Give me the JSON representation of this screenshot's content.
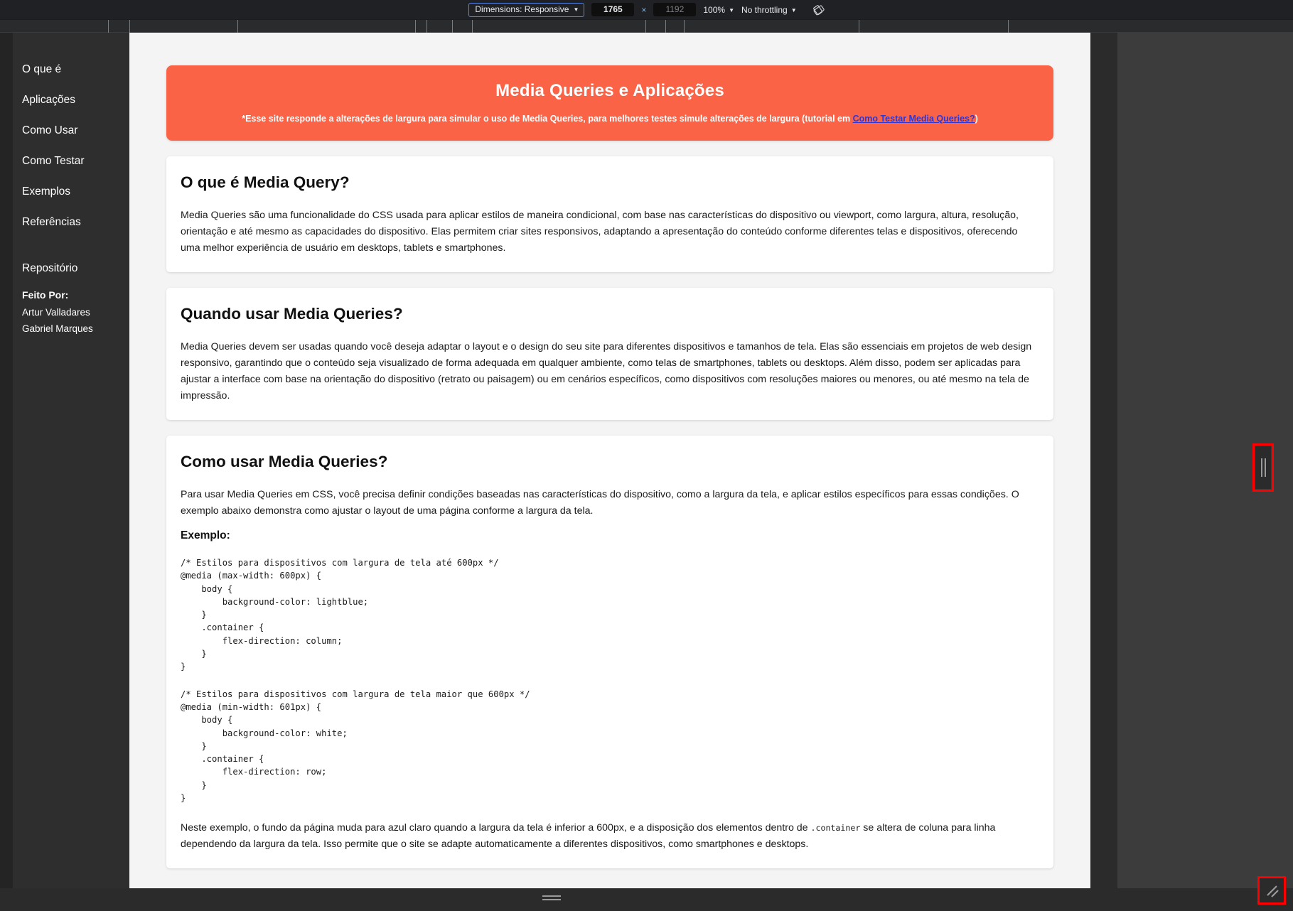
{
  "devtools": {
    "dimensions_label": "Dimensions: Responsive",
    "width_value": "1765",
    "height_value": "1192",
    "multiply_symbol": "×",
    "zoom_label": "100%",
    "throttling_label": "No throttling",
    "rotate_icon": "rotate-device-icon",
    "caret": "▼"
  },
  "sidebar": {
    "items": [
      {
        "label": "O que é"
      },
      {
        "label": "Aplicações"
      },
      {
        "label": "Como Usar"
      },
      {
        "label": "Como Testar"
      },
      {
        "label": "Exemplos"
      },
      {
        "label": "Referências"
      }
    ],
    "repository_label": "Repositório",
    "credits_title": "Feito Por:",
    "credits": [
      {
        "name": "Artur Valladares"
      },
      {
        "name": "Gabriel Marques"
      }
    ]
  },
  "banner": {
    "title": "Media Queries e Aplicações",
    "subtitle_prefix": "*Esse site responde a alterações de largura para simular o uso de Media Queries, para melhores testes simule alterações de largura (tutorial em ",
    "subtitle_link": "Como Testar Media Queries?",
    "subtitle_suffix": ")",
    "background_color": "#fb6347",
    "link_color": "#2a36d8"
  },
  "cards": [
    {
      "heading": "O que é Media Query?",
      "body": "Media Queries são uma funcionalidade do CSS usada para aplicar estilos de maneira condicional, com base nas características do dispositivo ou viewport, como largura, altura, resolução, orientação e até mesmo as capacidades do dispositivo. Elas permitem criar sites responsivos, adaptando a apresentação do conteúdo conforme diferentes telas e dispositivos, oferecendo uma melhor experiência de usuário em desktops, tablets e smartphones."
    },
    {
      "heading": "Quando usar Media Queries?",
      "body": "Media Queries devem ser usadas quando você deseja adaptar o layout e o design do seu site para diferentes dispositivos e tamanhos de tela. Elas são essenciais em projetos de web design responsivo, garantindo que o conteúdo seja visualizado de forma adequada em qualquer ambiente, como telas de smartphones, tablets ou desktops. Além disso, podem ser aplicadas para ajustar a interface com base na orientação do dispositivo (retrato ou paisagem) ou em cenários específicos, como dispositivos com resoluções maiores ou menores, ou até mesmo na tela de impressão."
    },
    {
      "heading": "Como usar Media Queries?",
      "body": "Para usar Media Queries em CSS, você precisa definir condições baseadas nas características do dispositivo, como a largura da tela, e aplicar estilos específicos para essas condições. O exemplo abaixo demonstra como ajustar o layout de uma página conforme a largura da tela.",
      "example_label": "Exemplo:",
      "code_block_1": "/* Estilos para dispositivos com largura de tela até 600px */\n@media (max-width: 600px) {\n    body {\n        background-color: lightblue;\n    }\n    .container {\n        flex-direction: column;\n    }\n}",
      "code_block_2": "/* Estilos para dispositivos com largura de tela maior que 600px */\n@media (min-width: 601px) {\n    body {\n        background-color: white;\n    }\n    .container {\n        flex-direction: row;\n    }\n}",
      "closing_part_1": "Neste exemplo, o fundo da página muda para azul claro quando a largura da tela é inferior a 600px, e a disposição dos elementos dentro de ",
      "closing_code": ".container",
      "closing_part_2": " se altera de coluna para linha dependendo da largura da tela. Isso permite que o site se adapte automaticamente a diferentes dispositivos, como smartphones e desktops."
    }
  ],
  "handles": {
    "right_handle": "resize-handle-right",
    "bottom_handle": "resize-handle-bottom",
    "corner_handle": "resize-handle-corner",
    "highlight_color": "#ff0000"
  }
}
